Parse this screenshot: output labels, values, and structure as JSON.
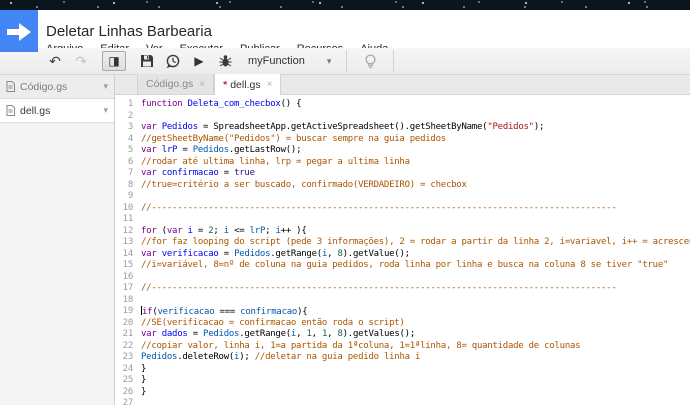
{
  "window": {
    "title": "Deletar Linhas Barbearia"
  },
  "menu": {
    "items": [
      "Arquivo",
      "Editar",
      "Ver",
      "Executar",
      "Publicar",
      "Recursos",
      "Ajuda"
    ]
  },
  "toolbar": {
    "undo": "↶",
    "redo": "↷",
    "panel_toggle": "◨",
    "play": "▶",
    "function_selector": {
      "label": "myFunction",
      "caret": "▾"
    }
  },
  "sidebar": {
    "files": [
      {
        "name": "Código.gs",
        "selected": false
      },
      {
        "name": "dell.gs",
        "selected": true
      }
    ]
  },
  "tabs": [
    {
      "label": "Código.gs",
      "dirty": false,
      "active": false,
      "close": "×"
    },
    {
      "label": "dell.gs",
      "dirty": true,
      "active": true,
      "close": "×"
    }
  ],
  "colors": {
    "brand_blue": "#4285f4",
    "dirty_red": "#cc2127",
    "token": {
      "kw": "#770088",
      "def": "#0000ee",
      "v2": "#0055aa",
      "str": "#aa1111",
      "cm": "#aa5500",
      "num": "#116644",
      "at": "#221199",
      "pl": "#000000"
    }
  },
  "editor": {
    "lines": [
      {
        "n": 1,
        "t": [
          [
            "kw",
            "function"
          ],
          [
            "pl",
            " "
          ],
          [
            "def",
            "Deleta_com_checbox"
          ],
          [
            "pl",
            "() {"
          ]
        ]
      },
      {
        "n": 2,
        "t": []
      },
      {
        "n": 3,
        "t": [
          [
            "kw",
            "var"
          ],
          [
            "pl",
            " "
          ],
          [
            "def",
            "Pedidos"
          ],
          [
            "pl",
            " = SpreadsheetApp.getActiveSpreadsheet().getSheetByName("
          ],
          [
            "str",
            "\"Pedidos\""
          ],
          [
            "pl",
            ");"
          ]
        ]
      },
      {
        "n": 4,
        "t": [
          [
            "cm",
            "//getSheetByName(\"Pedidos\") = buscar sempre na guia pedidos"
          ]
        ]
      },
      {
        "n": 5,
        "t": [
          [
            "kw",
            "var"
          ],
          [
            "pl",
            " "
          ],
          [
            "def",
            "lrP"
          ],
          [
            "pl",
            " = "
          ],
          [
            "v2",
            "Pedidos"
          ],
          [
            "pl",
            ".getLastRow();"
          ]
        ]
      },
      {
        "n": 6,
        "t": [
          [
            "cm",
            "//rodar até ultima linha, lrp = pegar a ultima linha"
          ]
        ]
      },
      {
        "n": 7,
        "t": [
          [
            "kw",
            "var"
          ],
          [
            "pl",
            " "
          ],
          [
            "def",
            "confirmacao"
          ],
          [
            "pl",
            " = "
          ],
          [
            "at",
            "true"
          ]
        ]
      },
      {
        "n": 8,
        "t": [
          [
            "cm",
            "//true=critério a ser buscado, confirmado(VERDADEIRO) = checbox"
          ]
        ]
      },
      {
        "n": 9,
        "t": []
      },
      {
        "n": 10,
        "t": [
          [
            "cm",
            "//------------------------------------------------------------------------------------------"
          ]
        ]
      },
      {
        "n": 11,
        "t": []
      },
      {
        "n": 12,
        "t": [
          [
            "kw",
            "for"
          ],
          [
            "pl",
            " ("
          ],
          [
            "kw",
            "var"
          ],
          [
            "pl",
            " "
          ],
          [
            "def",
            "i"
          ],
          [
            "pl",
            " = "
          ],
          [
            "num",
            "2"
          ],
          [
            "pl",
            "; "
          ],
          [
            "v2",
            "i"
          ],
          [
            "pl",
            " <= "
          ],
          [
            "v2",
            "lrP"
          ],
          [
            "pl",
            "; "
          ],
          [
            "v2",
            "i"
          ],
          [
            "pl",
            "++ ){"
          ]
        ]
      },
      {
        "n": 13,
        "t": [
          [
            "cm",
            "//for faz looping do script (pede 3 informações), 2 = rodar a partir da linha 2, i=variavel, i++ = acrescentar"
          ]
        ]
      },
      {
        "n": 14,
        "t": [
          [
            "kw",
            "var"
          ],
          [
            "pl",
            " "
          ],
          [
            "def",
            "verificacao"
          ],
          [
            "pl",
            " = "
          ],
          [
            "v2",
            "Pedidos"
          ],
          [
            "pl",
            ".getRange("
          ],
          [
            "v2",
            "i"
          ],
          [
            "pl",
            ", "
          ],
          [
            "num",
            "8"
          ],
          [
            "pl",
            ").getValue();"
          ]
        ]
      },
      {
        "n": 15,
        "t": [
          [
            "cm",
            "//i=variável, 8=nº de coluna na guia pedidos, roda linha por linha e busca na coluna 8 se tiver \"true\""
          ]
        ]
      },
      {
        "n": 16,
        "t": []
      },
      {
        "n": 17,
        "t": [
          [
            "cm",
            "//------------------------------------------------------------------------------------------"
          ]
        ]
      },
      {
        "n": 18,
        "t": []
      },
      {
        "n": 19,
        "caret": true,
        "t": [
          [
            "kw",
            "if"
          ],
          [
            "pl",
            "("
          ],
          [
            "v2",
            "verificacao"
          ],
          [
            "pl",
            " === "
          ],
          [
            "v2",
            "confirmacao"
          ],
          [
            "pl",
            "){"
          ]
        ]
      },
      {
        "n": 20,
        "t": [
          [
            "cm",
            "//SE(verificacao = confirmacao então roda o script)"
          ]
        ]
      },
      {
        "n": 21,
        "t": [
          [
            "kw",
            "var"
          ],
          [
            "pl",
            " "
          ],
          [
            "def",
            "dados"
          ],
          [
            "pl",
            " = "
          ],
          [
            "v2",
            "Pedidos"
          ],
          [
            "pl",
            ".getRange("
          ],
          [
            "v2",
            "i"
          ],
          [
            "pl",
            ", "
          ],
          [
            "num",
            "1"
          ],
          [
            "pl",
            ", "
          ],
          [
            "num",
            "1"
          ],
          [
            "pl",
            ", "
          ],
          [
            "num",
            "8"
          ],
          [
            "pl",
            ").getValues();"
          ]
        ]
      },
      {
        "n": 22,
        "t": [
          [
            "cm",
            "//copiar valor, linha i, 1=a partida da 1ªcoluna, 1=1ªlinha, 8= quantidade de colunas"
          ]
        ]
      },
      {
        "n": 23,
        "t": [
          [
            "v2",
            "Pedidos"
          ],
          [
            "pl",
            ".deleteRow("
          ],
          [
            "v2",
            "i"
          ],
          [
            "pl",
            "); "
          ],
          [
            "cm",
            "//deletar na guia pedido linha i"
          ]
        ]
      },
      {
        "n": 24,
        "t": [
          [
            "pl",
            "}"
          ]
        ]
      },
      {
        "n": 25,
        "t": [
          [
            "pl",
            "}"
          ]
        ]
      },
      {
        "n": 26,
        "t": [
          [
            "pl",
            "}"
          ]
        ]
      },
      {
        "n": 27,
        "t": []
      }
    ]
  }
}
